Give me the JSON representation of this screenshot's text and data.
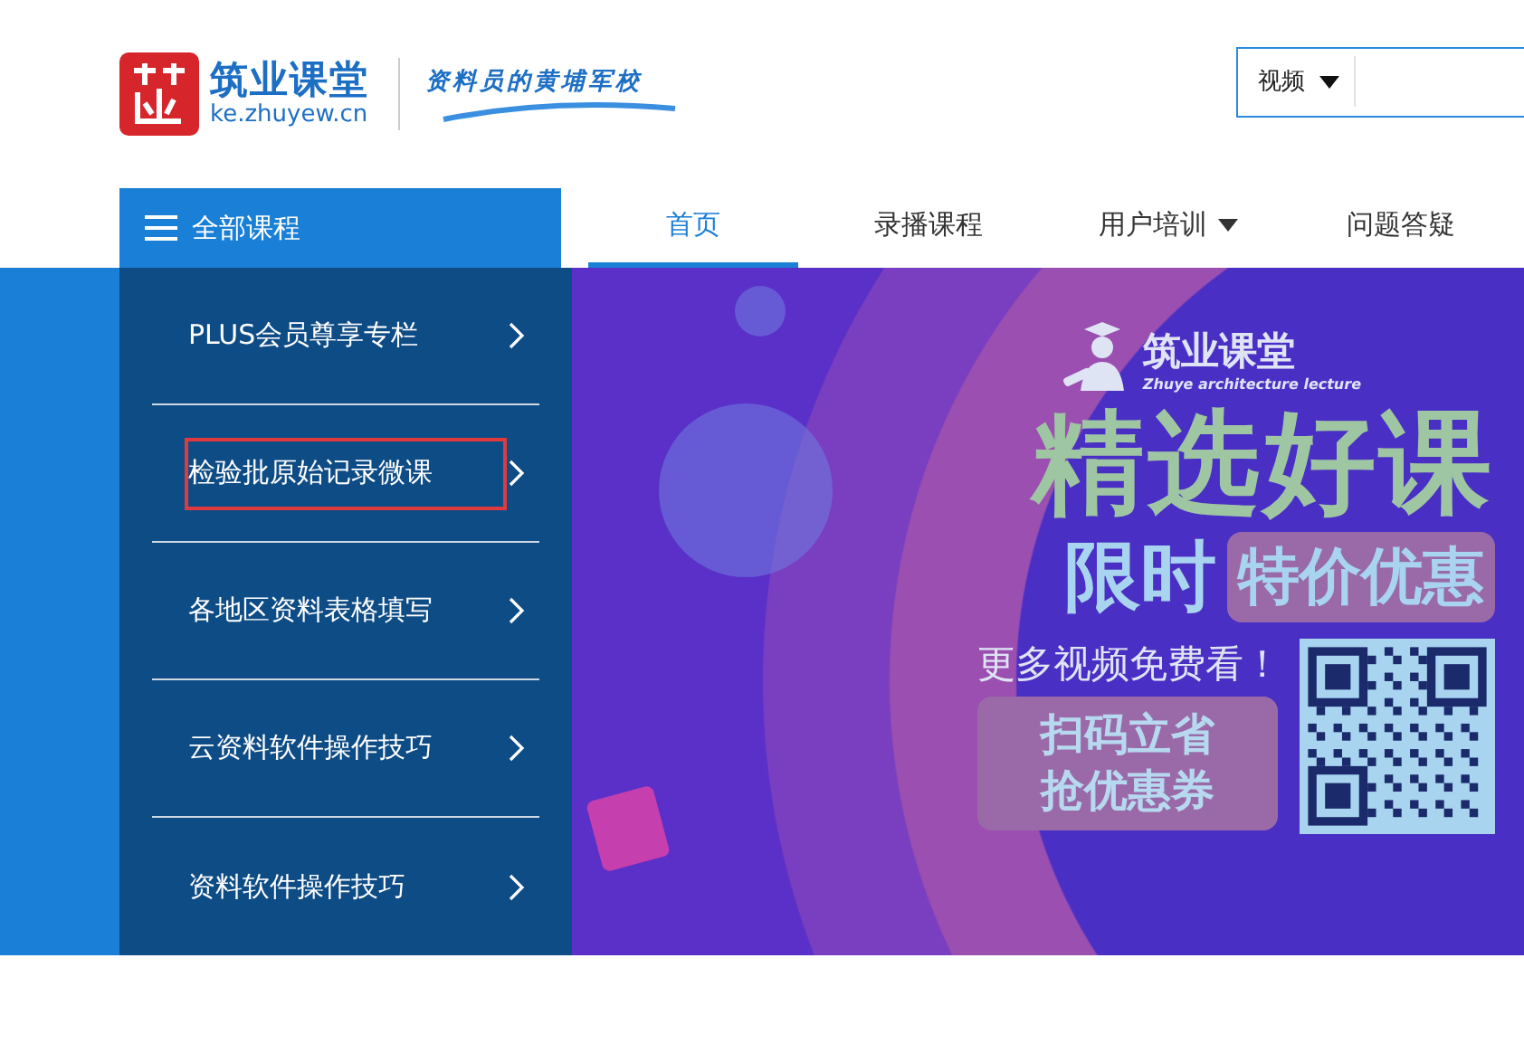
{
  "header": {
    "logo_text": "筑业课堂",
    "logo_domain": "ke.zhuyew.cn",
    "slogan": "资料员的黄埔军校",
    "search": {
      "category": "视频"
    }
  },
  "all_courses": {
    "label": "全部课程"
  },
  "nav": [
    {
      "label": "首页",
      "selected": true,
      "dropdown": false
    },
    {
      "label": "录播课程",
      "selected": false,
      "dropdown": false
    },
    {
      "label": "用户培训",
      "selected": false,
      "dropdown": true
    },
    {
      "label": "问题答疑",
      "selected": false,
      "dropdown": false
    }
  ],
  "sidebar": {
    "items": [
      {
        "label": "PLUS会员尊享专栏",
        "selected": false
      },
      {
        "label": "检验批原始记录微课",
        "selected": true
      },
      {
        "label": "各地区资料表格填写",
        "selected": false
      },
      {
        "label": "云资料软件操作技巧",
        "selected": false
      },
      {
        "label": "资料软件操作技巧",
        "selected": false
      }
    ]
  },
  "banner": {
    "brand": "筑业课堂",
    "brand_en": "Zhuye architecture lecture",
    "headline": "精选好课",
    "subline_left": "限时",
    "subline_right": "特价优惠",
    "tagline": "更多视频免费看！",
    "cta_lines": [
      "扫码立省",
      "抢优惠券"
    ]
  }
}
